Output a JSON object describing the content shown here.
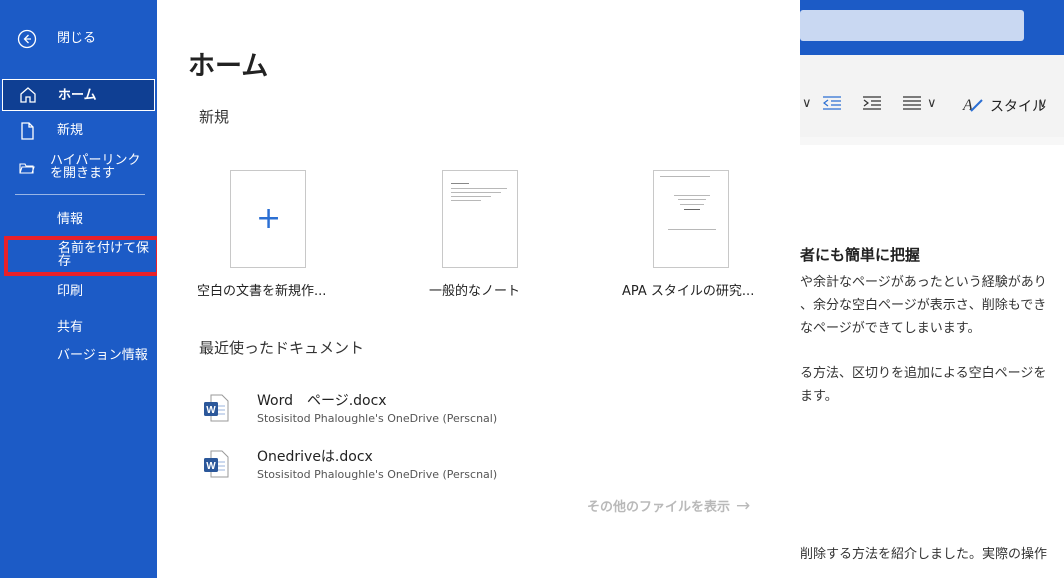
{
  "sidebar": {
    "back_label": "閉じる",
    "items": [
      {
        "label": "ホーム"
      },
      {
        "label": "新規"
      },
      {
        "label": "ハイパーリンクを開きます"
      },
      {
        "label": "情報"
      },
      {
        "label": "名前を付けて保存"
      },
      {
        "label": "印刷"
      },
      {
        "label": "共有"
      },
      {
        "label": "バージョン情報"
      }
    ]
  },
  "main": {
    "title": "ホーム",
    "new_section_label": "新規",
    "templates": [
      {
        "label": "空白の文書を新規作..."
      },
      {
        "label": "一般的なノート"
      },
      {
        "label": "APA スタイルの研究..."
      }
    ],
    "recent_section_label": "最近使ったドキュメント",
    "recent_files": [
      {
        "name": "Word　ページ.docx",
        "location": "Stosisitod Phaloughle's OneDrive (Perscnal)"
      },
      {
        "name": "Onedriveは.docx",
        "location": "Stosisitod Phaloughle's OneDrive (Perscnal)"
      }
    ],
    "more_files_label": "その他のファイルを表示"
  },
  "background_doc": {
    "ribbon_style_label": "スタイル",
    "heading": "者にも簡単に把握",
    "lines": [
      "や余計なページがあったという経験があり",
      "、余分な空白ページが表示さ、削除もでき",
      "なページができてしまいます。",
      "る方法、区切りを追加による空白ページを",
      "ます。",
      "削除する方法を紹介しました。実際の操作"
    ]
  },
  "colors": {
    "sidebar_bg": "#1c5bc6",
    "sidebar_selected_bg": "#0f3f93",
    "highlight_box": "#e8202a",
    "accent_plus": "#2b6fd3",
    "word_blue": "#2b579a"
  }
}
